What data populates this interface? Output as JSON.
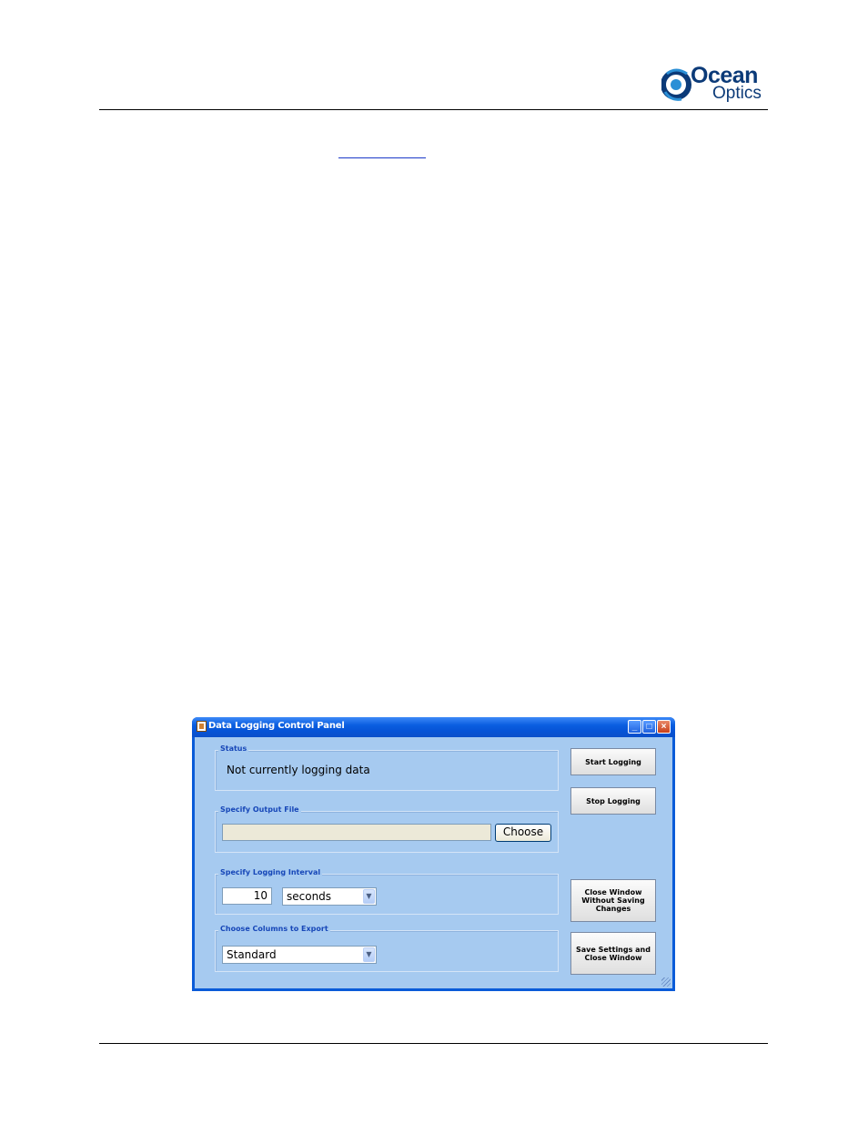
{
  "header": {
    "logo": {
      "line1": "Ocean",
      "line2": "Optics",
      "icon": "ocean-optics-swirl-logo"
    }
  },
  "window": {
    "title": "Data Logging Control Panel",
    "controls": {
      "minimize": "_",
      "maximize": "□",
      "close": "×"
    },
    "status": {
      "label": "Status",
      "text": "Not currently logging data"
    },
    "output_file": {
      "label": "Specify Output File",
      "value": "",
      "choose_label": "Choose"
    },
    "interval": {
      "label": "Specify Logging Interval",
      "value": "10",
      "unit_selected": "seconds"
    },
    "columns": {
      "label": "Choose Columns to Export",
      "selected": "Standard"
    },
    "buttons": {
      "start": "Start Logging",
      "stop": "Stop Logging",
      "close_without_saving": "Close Window\nWithout Saving\nChanges",
      "save_and_close": "Save Settings and\nClose Window"
    }
  },
  "colors": {
    "brand": "#0b3a78",
    "titlebar": "#0a5ee0",
    "client_bg": "#a6caf0",
    "group_label": "#1747b8"
  }
}
